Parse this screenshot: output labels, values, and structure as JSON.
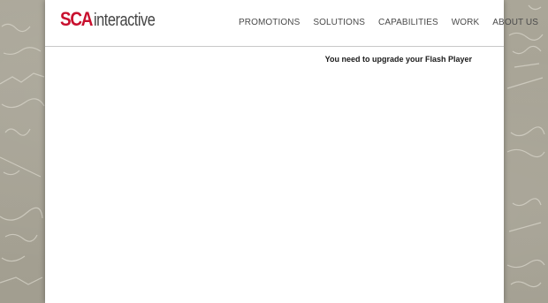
{
  "logo": {
    "brand_mark": "SCA",
    "brand_word": "interactive"
  },
  "nav": {
    "items": [
      {
        "label": "PROMOTIONS"
      },
      {
        "label": "SOLUTIONS"
      },
      {
        "label": "CAPABILITIES"
      },
      {
        "label": "WORK"
      },
      {
        "label": "ABOUT US"
      }
    ]
  },
  "content": {
    "flash_notice": "You need to upgrade your Flash Player"
  },
  "colors": {
    "brand_red": "#c8102e",
    "brand_gray": "#444444",
    "backdrop": "#a9a597"
  }
}
